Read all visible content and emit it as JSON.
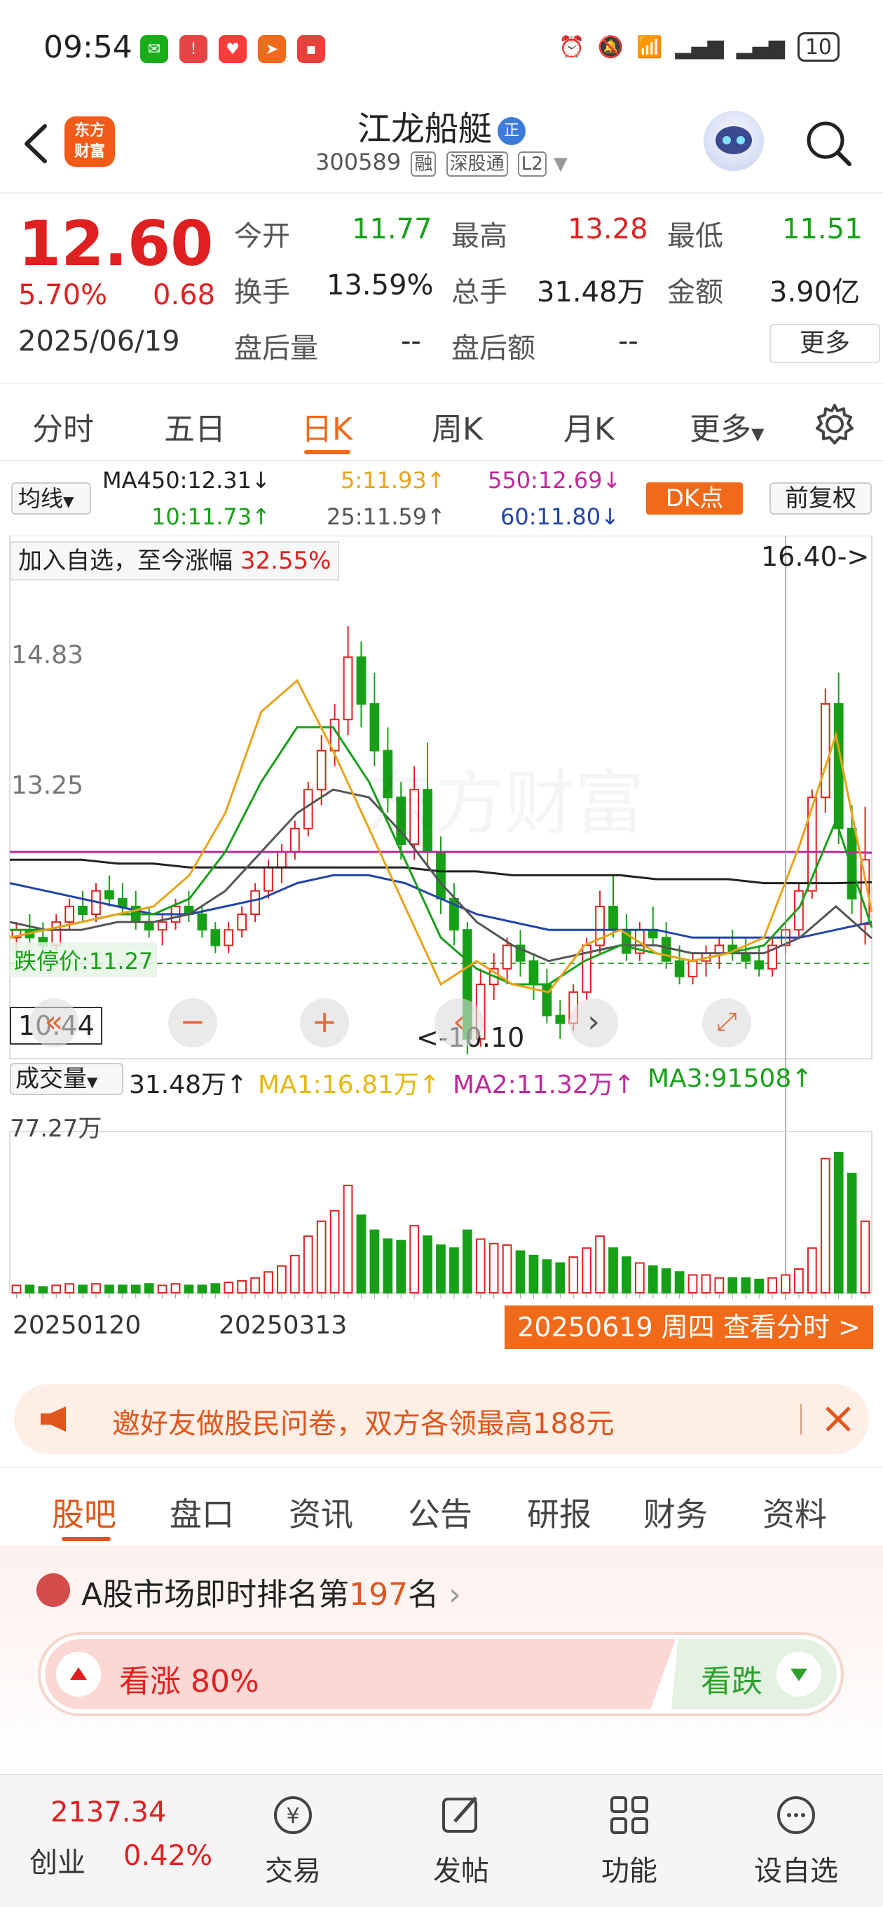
{
  "status_bar": {
    "time": "09:54",
    "battery": "10"
  },
  "header": {
    "logo_line1": "东方",
    "logo_line2": "财富",
    "stock_name": "江龙船艇",
    "name_badge": "正",
    "stock_code": "300589",
    "tags": [
      "融",
      "深股通",
      "L2"
    ]
  },
  "quote": {
    "price": "12.60",
    "change_pct": "5.70%",
    "change": "0.68",
    "date": "2025/06/19",
    "fields": [
      {
        "label": "今开",
        "value": "11.77",
        "color": "green"
      },
      {
        "label": "最高",
        "value": "13.28",
        "color": "red"
      },
      {
        "label": "最低",
        "value": "11.51",
        "color": "green"
      },
      {
        "label": "换手",
        "value": "13.59%",
        "color": "dark"
      },
      {
        "label": "总手",
        "value": "31.48万",
        "color": "dark"
      },
      {
        "label": "金额",
        "value": "3.90亿",
        "color": "dark"
      },
      {
        "label": "盘后量",
        "value": "--",
        "color": "dark"
      },
      {
        "label": "盘后额",
        "value": "--",
        "color": "dark"
      }
    ],
    "more_label": "更多"
  },
  "period_tabs": {
    "items": [
      "分时",
      "五日",
      "日K",
      "周K",
      "月K",
      "更多"
    ],
    "active": "日K"
  },
  "ma_legend": {
    "selector": "均线",
    "ma450": "MA450:12.31↓",
    "ma5": "5:11.93↑",
    "ma550": "550:12.69↓",
    "ma10": "10:11.73↑",
    "ma25": "25:11.59↑",
    "ma60": "60:11.80↓",
    "dk_button": "DK点",
    "adjust_button": "前复权",
    "colors": {
      "ma450": "#222222",
      "ma5": "#e8a317",
      "ma550": "#c0289a",
      "ma10": "#17a017",
      "ma25": "#555555",
      "ma60": "#2244aa"
    }
  },
  "chart": {
    "add_fav_label": "加入自选，至今涨幅",
    "add_fav_pct": "32.55%",
    "high_marker": "16.40->",
    "price_labels": [
      "14.83",
      "13.25"
    ],
    "limit_down_label": "跌停价:11.27",
    "cursor_price": "10.44",
    "low_marker": "<-10.10",
    "watermark": "东方财富",
    "zoom_minus": "−",
    "zoom_plus": "+",
    "volume_selector": "成交量",
    "volume_total": "31.48万↑",
    "vol_ma1": "MA1:16.81万↑",
    "vol_ma2": "MA2:11.32万↑",
    "vol_ma3": "MA3:91508↑",
    "volume_max": "77.27万",
    "x_dates": [
      "20250120",
      "20250313"
    ],
    "x_tip": "20250619 周四 查看分时 >",
    "up_color": "#e02020",
    "down_color": "#17a017"
  },
  "promo": {
    "text": "邀好友做股民问卷，双方各领最高188元"
  },
  "section_tabs": {
    "items": [
      "股吧",
      "盘口",
      "资讯",
      "公告",
      "研报",
      "财务",
      "资料"
    ],
    "active": "股吧"
  },
  "ranking": {
    "prefix": "A股市场即时排名第",
    "rank": "197",
    "suffix": "名",
    "up_label": "看涨 80%",
    "down_label": "看跌"
  },
  "bottom_nav": {
    "index_value": "2137.34",
    "index_name": "创业",
    "index_pct": "0.42%",
    "items": [
      "交易",
      "发帖",
      "功能",
      "设自选"
    ]
  },
  "chart_data": {
    "type": "candlestick",
    "x_start": "20250120",
    "x_mid_label": "20250313",
    "x_end": "20250619",
    "y_labels": [
      "16.40",
      "14.83",
      "13.25",
      "11.27",
      "10.10"
    ],
    "latest": {
      "open": 11.77,
      "high": 13.28,
      "low": 11.51,
      "close": 12.6
    },
    "period_high": 16.4,
    "period_low": 10.1,
    "volume_max": "77.27万",
    "candles": [
      [
        11.6,
        11.8,
        11.4,
        11.7
      ],
      [
        11.7,
        11.9,
        11.5,
        11.6
      ],
      [
        11.6,
        11.8,
        11.4,
        11.5
      ],
      [
        11.5,
        11.9,
        11.4,
        11.8
      ],
      [
        11.8,
        12.1,
        11.7,
        12.0
      ],
      [
        12.0,
        12.2,
        11.8,
        11.9
      ],
      [
        11.9,
        12.3,
        11.8,
        12.2
      ],
      [
        12.2,
        12.4,
        12.0,
        12.1
      ],
      [
        12.1,
        12.3,
        11.9,
        12.0
      ],
      [
        12.0,
        12.2,
        11.7,
        11.8
      ],
      [
        11.8,
        12.0,
        11.6,
        11.7
      ],
      [
        11.7,
        11.9,
        11.5,
        11.8
      ],
      [
        11.8,
        12.1,
        11.7,
        12.0
      ],
      [
        12.0,
        12.2,
        11.8,
        11.9
      ],
      [
        11.9,
        12.0,
        11.6,
        11.7
      ],
      [
        11.7,
        11.8,
        11.4,
        11.5
      ],
      [
        11.5,
        11.8,
        11.4,
        11.7
      ],
      [
        11.7,
        12.0,
        11.6,
        11.9
      ],
      [
        11.9,
        12.3,
        11.8,
        12.2
      ],
      [
        12.2,
        12.6,
        12.1,
        12.5
      ],
      [
        12.5,
        12.8,
        12.3,
        12.7
      ],
      [
        12.7,
        13.1,
        12.6,
        13.0
      ],
      [
        13.0,
        13.6,
        12.9,
        13.5
      ],
      [
        13.5,
        14.2,
        13.3,
        14.0
      ],
      [
        14.0,
        14.6,
        13.8,
        14.4
      ],
      [
        14.4,
        15.6,
        14.2,
        15.2
      ],
      [
        15.2,
        15.4,
        14.3,
        14.6
      ],
      [
        14.6,
        15.0,
        13.8,
        14.0
      ],
      [
        14.0,
        14.3,
        13.2,
        13.4
      ],
      [
        13.4,
        13.6,
        12.6,
        12.8
      ],
      [
        12.8,
        13.8,
        12.6,
        13.5
      ],
      [
        13.5,
        14.1,
        12.5,
        12.7
      ],
      [
        12.7,
        12.9,
        11.9,
        12.1
      ],
      [
        12.1,
        12.3,
        11.5,
        11.7
      ],
      [
        11.7,
        11.8,
        10.1,
        10.3
      ],
      [
        10.3,
        11.2,
        10.2,
        11.0
      ],
      [
        11.0,
        11.4,
        10.8,
        11.2
      ],
      [
        11.2,
        11.6,
        11.0,
        11.5
      ],
      [
        11.5,
        11.7,
        11.1,
        11.3
      ],
      [
        11.3,
        11.4,
        10.8,
        11.0
      ],
      [
        11.0,
        11.2,
        10.5,
        10.6
      ],
      [
        10.6,
        10.8,
        10.3,
        10.5
      ],
      [
        10.5,
        11.0,
        10.4,
        10.9
      ],
      [
        10.9,
        11.6,
        10.8,
        11.5
      ],
      [
        11.5,
        12.2,
        11.4,
        12.0
      ],
      [
        12.0,
        12.4,
        11.6,
        11.7
      ],
      [
        11.7,
        11.9,
        11.3,
        11.4
      ],
      [
        11.4,
        11.8,
        11.3,
        11.7
      ],
      [
        11.7,
        12.0,
        11.5,
        11.6
      ],
      [
        11.6,
        11.8,
        11.2,
        11.3
      ],
      [
        11.3,
        11.5,
        11.0,
        11.1
      ],
      [
        11.1,
        11.4,
        11.0,
        11.3
      ],
      [
        11.3,
        11.5,
        11.1,
        11.4
      ],
      [
        11.4,
        11.6,
        11.2,
        11.5
      ],
      [
        11.5,
        11.7,
        11.3,
        11.4
      ],
      [
        11.4,
        11.6,
        11.2,
        11.3
      ],
      [
        11.3,
        11.5,
        11.1,
        11.2
      ],
      [
        11.2,
        11.6,
        11.1,
        11.5
      ],
      [
        11.5,
        11.8,
        11.4,
        11.7
      ],
      [
        11.7,
        12.3,
        11.6,
        12.2
      ],
      [
        12.2,
        13.5,
        12.1,
        13.4
      ],
      [
        13.4,
        14.8,
        13.2,
        14.6
      ],
      [
        14.6,
        15.0,
        12.8,
        13.0
      ],
      [
        13.0,
        13.3,
        11.9,
        12.1
      ],
      [
        11.77,
        13.28,
        11.51,
        12.6
      ]
    ],
    "ma5_levels": [
      11.6,
      11.7,
      11.8,
      11.9,
      12.0,
      12.4,
      13.2,
      14.5,
      14.9,
      14.0,
      13.0,
      12.0,
      11.0,
      11.3,
      11.0,
      10.9,
      11.5,
      11.7,
      11.4,
      11.3,
      11.4,
      11.6,
      12.8,
      14.2,
      11.93
    ],
    "ma10_levels": [
      11.7,
      11.7,
      11.8,
      11.9,
      11.9,
      12.1,
      12.7,
      13.6,
      14.3,
      14.3,
      13.6,
      12.6,
      11.6,
      11.2,
      11.0,
      11.0,
      11.3,
      11.5,
      11.4,
      11.3,
      11.4,
      11.5,
      12.0,
      13.1,
      11.73
    ],
    "ma25_levels": [
      11.8,
      11.7,
      11.7,
      11.8,
      11.8,
      11.9,
      12.2,
      12.7,
      13.2,
      13.5,
      13.4,
      12.9,
      12.3,
      11.8,
      11.5,
      11.3,
      11.4,
      11.5,
      11.5,
      11.4,
      11.4,
      11.4,
      11.6,
      12.0,
      11.59
    ],
    "ma60_levels": [
      12.3,
      12.2,
      12.1,
      12.0,
      11.9,
      11.9,
      12.0,
      12.1,
      12.3,
      12.4,
      12.4,
      12.3,
      12.1,
      11.9,
      11.8,
      11.7,
      11.7,
      11.7,
      11.7,
      11.6,
      11.6,
      11.6,
      11.6,
      11.7,
      11.8
    ],
    "ma450_levels": [
      12.6,
      12.6,
      12.6,
      12.55,
      12.55,
      12.5,
      12.5,
      12.5,
      12.5,
      12.5,
      12.5,
      12.5,
      12.45,
      12.45,
      12.4,
      12.4,
      12.4,
      12.4,
      12.35,
      12.35,
      12.35,
      12.3,
      12.3,
      12.3,
      12.31
    ],
    "ma550_levels": [
      12.7,
      12.7,
      12.7,
      12.7,
      12.7,
      12.7,
      12.7,
      12.7,
      12.7,
      12.7,
      12.7,
      12.7,
      12.7,
      12.7,
      12.7,
      12.7,
      12.7,
      12.7,
      12.7,
      12.7,
      12.7,
      12.7,
      12.7,
      12.7,
      12.69
    ],
    "volumes": [
      0.05,
      0.05,
      0.04,
      0.05,
      0.06,
      0.05,
      0.06,
      0.05,
      0.05,
      0.05,
      0.06,
      0.05,
      0.06,
      0.05,
      0.05,
      0.06,
      0.07,
      0.08,
      0.1,
      0.14,
      0.18,
      0.25,
      0.38,
      0.48,
      0.55,
      0.72,
      0.52,
      0.42,
      0.36,
      0.35,
      0.45,
      0.38,
      0.32,
      0.3,
      0.42,
      0.36,
      0.33,
      0.32,
      0.28,
      0.25,
      0.22,
      0.2,
      0.24,
      0.3,
      0.38,
      0.3,
      0.24,
      0.2,
      0.18,
      0.16,
      0.14,
      0.12,
      0.12,
      0.1,
      0.1,
      0.1,
      0.09,
      0.1,
      0.12,
      0.16,
      0.3,
      0.9,
      0.94,
      0.8,
      0.48
    ],
    "ylim": [
      10.1,
      16.4
    ]
  }
}
